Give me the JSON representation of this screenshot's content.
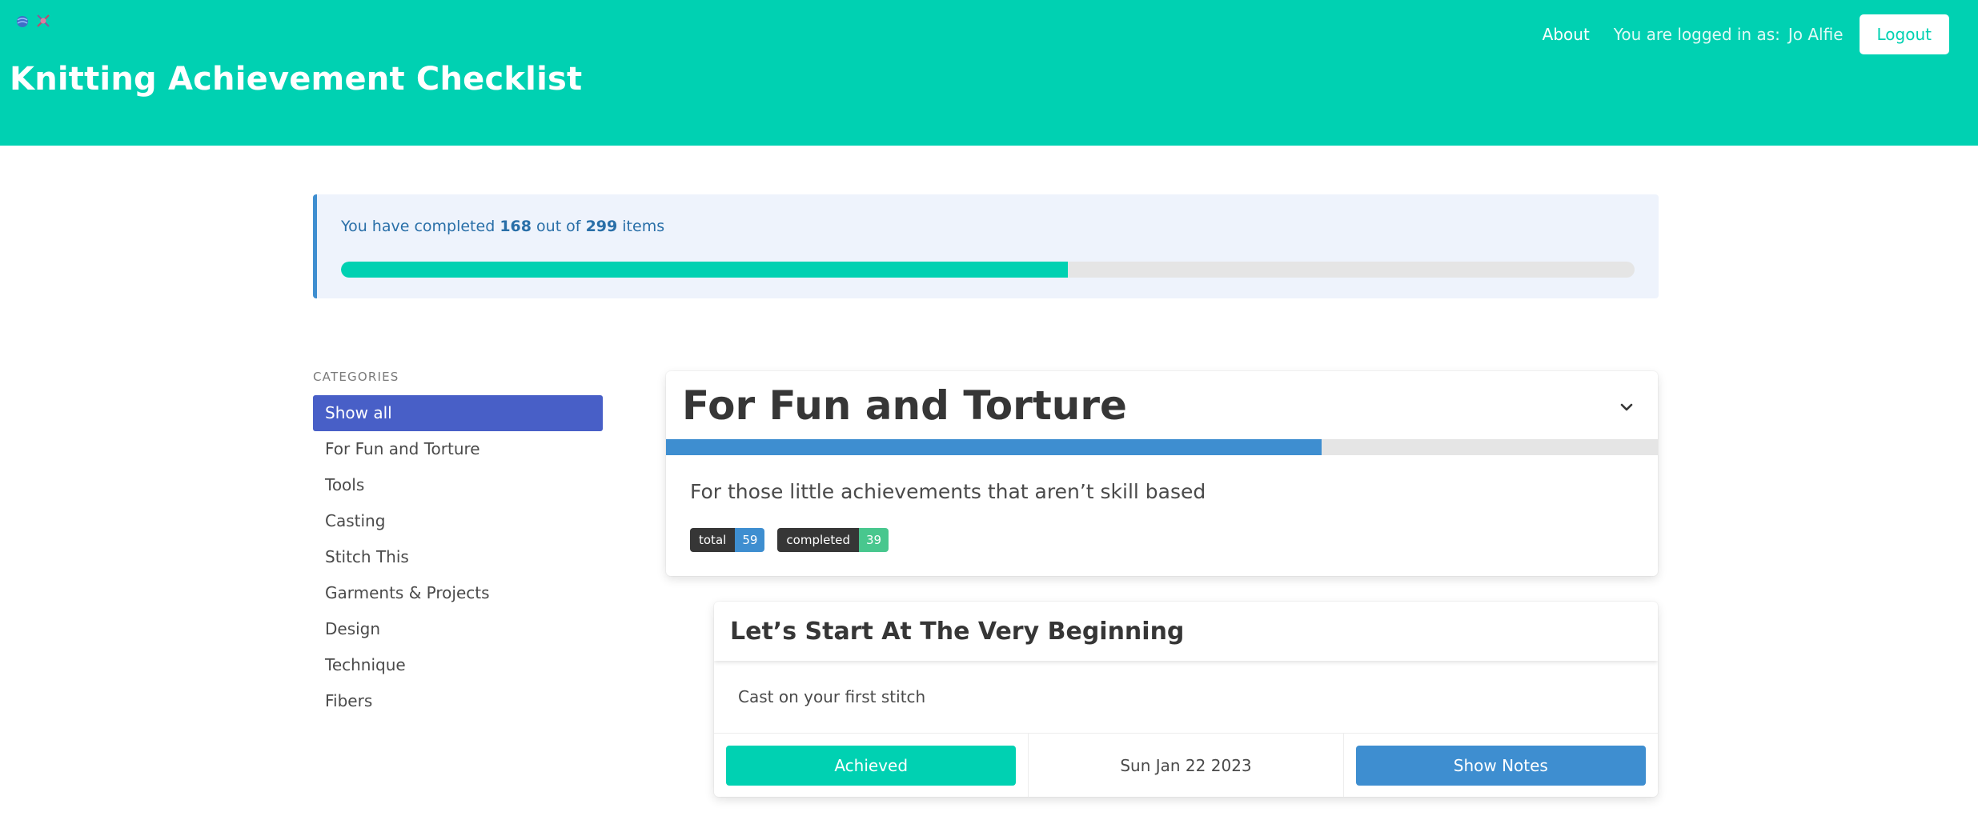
{
  "header": {
    "title": "Knitting Achievement Checklist",
    "nav_about": "About",
    "logged_in_prefix": "You are logged in as:",
    "user_name": "Jo Alfie",
    "logout_label": "Logout",
    "icons": [
      "yarn-ball-icon",
      "knitting-needles-icon"
    ]
  },
  "progress": {
    "text_prefix": "You have completed",
    "completed": "168",
    "text_middle": "out of",
    "total": "299",
    "text_suffix": "items",
    "fraction": 0.5619
  },
  "sidebar": {
    "label": "Categories",
    "items": [
      {
        "label": "Show all",
        "active": true
      },
      {
        "label": "For Fun and Torture"
      },
      {
        "label": "Tools"
      },
      {
        "label": "Casting"
      },
      {
        "label": "Stitch This"
      },
      {
        "label": "Garments & Projects"
      },
      {
        "label": "Design"
      },
      {
        "label": "Technique"
      },
      {
        "label": "Fibers"
      }
    ]
  },
  "category": {
    "title": "For Fun and Torture",
    "description": "For those little achievements that aren’t skill based",
    "total_label": "total",
    "total_value": "59",
    "completed_label": "completed",
    "completed_value": "39",
    "fraction": 0.661,
    "chevron_icon": "chevron-down-icon"
  },
  "item": {
    "title": "Let’s Start At The Very Beginning",
    "description": "Cast on your first stitch",
    "status_label": "Achieved",
    "date": "Sun Jan 22 2023",
    "notes_label": "Show Notes"
  },
  "colors": {
    "primary": "#00d1b2",
    "link": "#485fc7",
    "info": "#3e8ed0",
    "success": "#48c78e"
  }
}
